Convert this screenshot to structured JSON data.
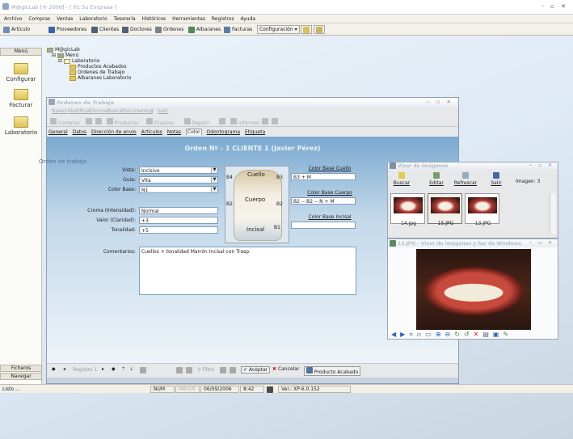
{
  "app": {
    "title": "M@gicLab [® 2006] - [ 01 Su Empresa ]",
    "controls": "- ▫ ✕"
  },
  "menubar": [
    "Archivo",
    "Compras",
    "Ventas",
    "Laboratorio",
    "Tesorería",
    "Históricos",
    "Herramientas",
    "Registros",
    "Ayuda"
  ],
  "toolbar": {
    "articulo": "Artículo",
    "proveedores": "Proveedores",
    "clientes": "Clientes",
    "doctores": "Doctores",
    "ordenes": "Ordenes",
    "albaranes": "Albaranes",
    "facturas": "Facturas",
    "configuracion": "Configuración"
  },
  "sidebar": {
    "menu": "Menú",
    "configurar": "Configurar",
    "facturar": "Facturar",
    "laboratorio": "Laboratorio",
    "ficheros": "Ficheros",
    "navegar": "Navegar"
  },
  "tree": {
    "root": "M@gicLab",
    "menu": "Menú",
    "laboratorio": "Laboratorio",
    "items": [
      "Productos Acabados",
      "Ordenes de Trabajo",
      "Albaranes Laboratorio"
    ]
  },
  "ordenes": {
    "title": "Ordenes de Trabajo",
    "tb1": [
      "Nuevo",
      "Modificar",
      "Eliminar",
      "Buscar",
      "Documentos",
      "Salir"
    ],
    "tb2": {
      "compras": "Compras",
      "productos": "Productos",
      "finalizar": "Finalizar",
      "repetir": "Repetir",
      "informes": "Informes"
    },
    "tabs": [
      "General",
      "Datos",
      "Dirección de envío",
      "Artículos",
      "Notas",
      "Color",
      "Odontograma",
      "Etiqueta"
    ],
    "header": "Orden Nº - 1  CLIENTE 1 (Javier Pérez)",
    "orden_label": "Orden de trabajo",
    "fields": {
      "vista_label": "Vista:",
      "vista": "Incisivo",
      "guia_label": "Guia:",
      "guia": "Vita",
      "color_base_label": "Color Base:",
      "color_base": "N1",
      "croma_label": "Croma (Intensidad):",
      "croma": "Normal",
      "valor_label": "Valor (Claridad):",
      "valor": "+3",
      "tonalidad_label": "Tonalidad:",
      "tonalidad": "+5",
      "comentarios_label": "Comentarios:",
      "comentarios": "Cuellos + tonalidad Marrón Incisal con Trasp."
    },
    "tooth": {
      "cuello": "Cuello",
      "cuerpo": "Cuerpo",
      "incisal": "Incisal",
      "b4": "B4",
      "b3": "B3",
      "b2": "B2",
      "b1": "B1",
      "b2l": "B2"
    },
    "color_cuello_label": "Color Base Cuello",
    "color_cuello": "B3 + M",
    "color_cuerpo_label": "Color Base Cuerpo",
    "color_cuerpo": "B2 -- B2 -- N + M",
    "color_incisal_label": "Color Base Incisal",
    "color_incisal": "",
    "bottom": {
      "registro": "Registro 1",
      "filtro": "Filtro",
      "aceptar": "Aceptar",
      "cancelar": "Cancelar",
      "producto": "Producto Acabado"
    }
  },
  "visor": {
    "title": "Visor de Imágenes",
    "buscar": "Buscar",
    "editar": "Editar",
    "refrescar": "Refrescar",
    "salir": "Salir",
    "imagenes": "Imagen: 3",
    "thumbs": [
      "14.jpg",
      "15.JPG",
      "13.JPG"
    ]
  },
  "viewer": {
    "title": "13.JPG - Visor de imágenes y fax de Windows"
  },
  "status": {
    "left": "Listo ...",
    "num": "NUM",
    "mayus": "MAYÚS",
    "date": "06/09/2006",
    "time": "8:42",
    "version": "Ver.: XP-6.0.152"
  }
}
